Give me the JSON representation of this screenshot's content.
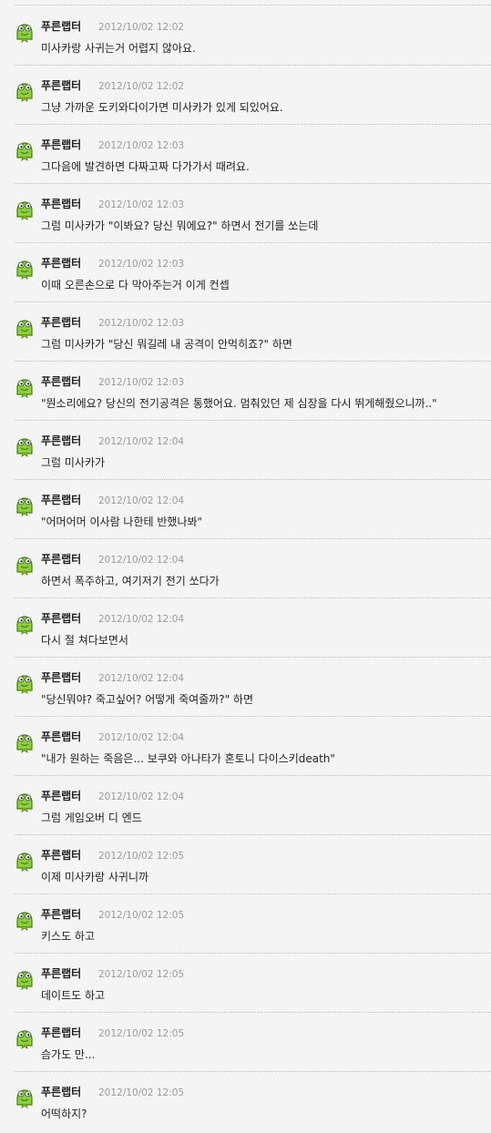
{
  "comments": [
    {
      "author": "푸른랩터",
      "time": "2012/10/02 12:02",
      "text": "미사카랑 사귀는거 어렵지 않아요."
    },
    {
      "author": "푸른랩터",
      "time": "2012/10/02 12:02",
      "text": "그냥 가까운 도키와다이가면 미사카가 있게 되있어요."
    },
    {
      "author": "푸른랩터",
      "time": "2012/10/02 12:03",
      "text": "그다음에 발견하면 다짜고짜 다가가서 때려요."
    },
    {
      "author": "푸른랩터",
      "time": "2012/10/02 12:03",
      "text": "그럼 미사카가 \"이봐요? 당신 뭐에요?\" 하면서 전기를 쏘는데"
    },
    {
      "author": "푸른랩터",
      "time": "2012/10/02 12:03",
      "text": "이때 오른손으로 다 막아주는거 이게 컨셉"
    },
    {
      "author": "푸른랩터",
      "time": "2012/10/02 12:03",
      "text": "그럼 미사카가 \"당신 뭐길레 내 공격이 안먹히죠?\" 하면"
    },
    {
      "author": "푸른랩터",
      "time": "2012/10/02 12:03",
      "text": "\"뭔소리에요? 당신의 전기공격은 통했어요. 멈춰있던 제 심장을 다시 뛰게해줬으니까..\""
    },
    {
      "author": "푸른랩터",
      "time": "2012/10/02 12:04",
      "text": "그럼 미사카가"
    },
    {
      "author": "푸른랩터",
      "time": "2012/10/02 12:04",
      "text": "\"어머어머 이사람 나한테 반했나봐\""
    },
    {
      "author": "푸른랩터",
      "time": "2012/10/02 12:04",
      "text": "하면서 폭주하고, 여기저기 전기 쏘다가"
    },
    {
      "author": "푸른랩터",
      "time": "2012/10/02 12:04",
      "text": "다시 절 쳐다보면서"
    },
    {
      "author": "푸른랩터",
      "time": "2012/10/02 12:04",
      "text": "\"당신뭐야? 죽고싶어? 어떻게 죽여줄까?\" 하면"
    },
    {
      "author": "푸른랩터",
      "time": "2012/10/02 12:04",
      "text": "\"내가 원하는 죽음은... 보쿠와 아나타가 혼토니 다이스키death\""
    },
    {
      "author": "푸른랩터",
      "time": "2012/10/02 12:04",
      "text": "그럼 게임오버 디 엔드"
    },
    {
      "author": "푸른랩터",
      "time": "2012/10/02 12:05",
      "text": "이제 미사카랑 사귀니까"
    },
    {
      "author": "푸른랩터",
      "time": "2012/10/02 12:05",
      "text": "키스도 하고"
    },
    {
      "author": "푸른랩터",
      "time": "2012/10/02 12:05",
      "text": "데이트도 하고"
    },
    {
      "author": "푸른랩터",
      "time": "2012/10/02 12:05",
      "text": "슴가도 만..."
    },
    {
      "author": "푸른랩터",
      "time": "2012/10/02 12:05",
      "text": "어떡하지?"
    }
  ],
  "avatar_icon": "green-frog-avatar-icon",
  "colors": {
    "background": "#f4f4f4",
    "text": "#222222",
    "timestamp": "#9a9a9a",
    "divider": "#bdbdbd",
    "avatar_green": "#8fcf3c",
    "avatar_dark": "#3f7f1b"
  }
}
